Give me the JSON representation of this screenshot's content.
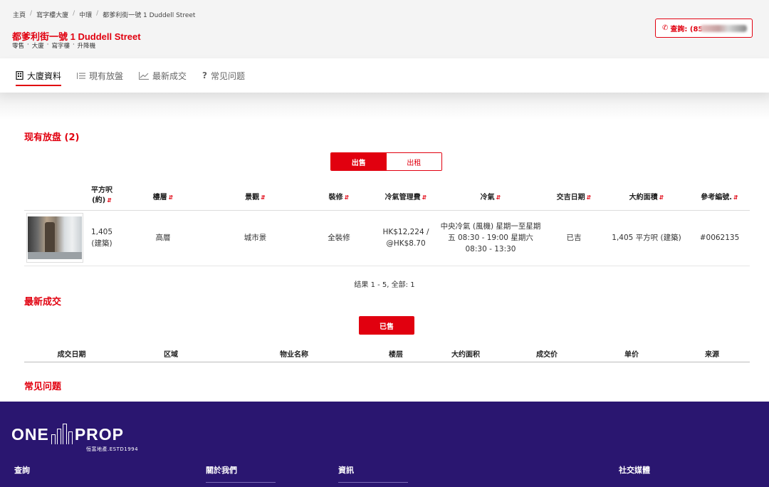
{
  "breadcrumb": [
    "主頁",
    "寫字樓大廈",
    "中環",
    "都爹利街一號 1 Duddell Street"
  ],
  "building": {
    "title": "都爹利街一號 1 Duddell Street",
    "tags": [
      "零售",
      "·",
      "大廈",
      "·",
      "寫字樓",
      "·",
      "升降機"
    ]
  },
  "enquiry": {
    "label": "查詢: (85",
    "icon": "phone-icon"
  },
  "tabs": [
    {
      "label": "大廈資料",
      "icon": "building-icon",
      "active": true
    },
    {
      "label": "現有放盤",
      "icon": "list-icon",
      "active": false
    },
    {
      "label": "最新成交",
      "icon": "chart-icon",
      "active": false
    },
    {
      "label": "常见问题",
      "icon": "question-icon",
      "active": false
    }
  ],
  "listings": {
    "title": "现有放盘 (2)",
    "toggle": {
      "sale": "出售",
      "rent": "出租",
      "selected": "sale"
    },
    "columns": [
      "平方呎\n(約)",
      "樓層",
      "景觀",
      "裝修",
      "冷氣管理費",
      "冷氣",
      "交吉日期",
      "大約面積",
      "參考編號."
    ],
    "col1a": "平方呎",
    "col1b": "(約)",
    "rows": [
      {
        "area": "1,405",
        "area_type": "(建築)",
        "floor": "高層",
        "view": "城市景",
        "decoration": "全裝修",
        "ac_fee": "HK$12,224 /",
        "ac_fee_rate": "@HK$8.70",
        "ac": "中央冷氣 (風機) 星期一至星期五 08:30 - 19:00 星期六 08:30 - 13:30",
        "vacant": "已吉",
        "approx_area": "1,405 平方呎 (建築)",
        "ref": "#0062135"
      }
    ],
    "results": "结果 1 - 5, 全部: 1"
  },
  "transactions": {
    "title": "最新成交",
    "sold_label": "已售",
    "columns": [
      "成交日期",
      "区域",
      "物业名称",
      "楼层",
      "大约面积",
      "成交价",
      "单价",
      "来源"
    ]
  },
  "faq": {
    "title": "常见问题"
  },
  "footer": {
    "logo_left": "ONE",
    "logo_right": "PROP",
    "logo_sub": "恒富地產.ESTD1994",
    "cols": [
      "查詢",
      "關於我們",
      "資訊",
      "社交媒體"
    ]
  },
  "colors": {
    "brand_red": "#e1000f",
    "footer_bg": "#2a1670"
  }
}
